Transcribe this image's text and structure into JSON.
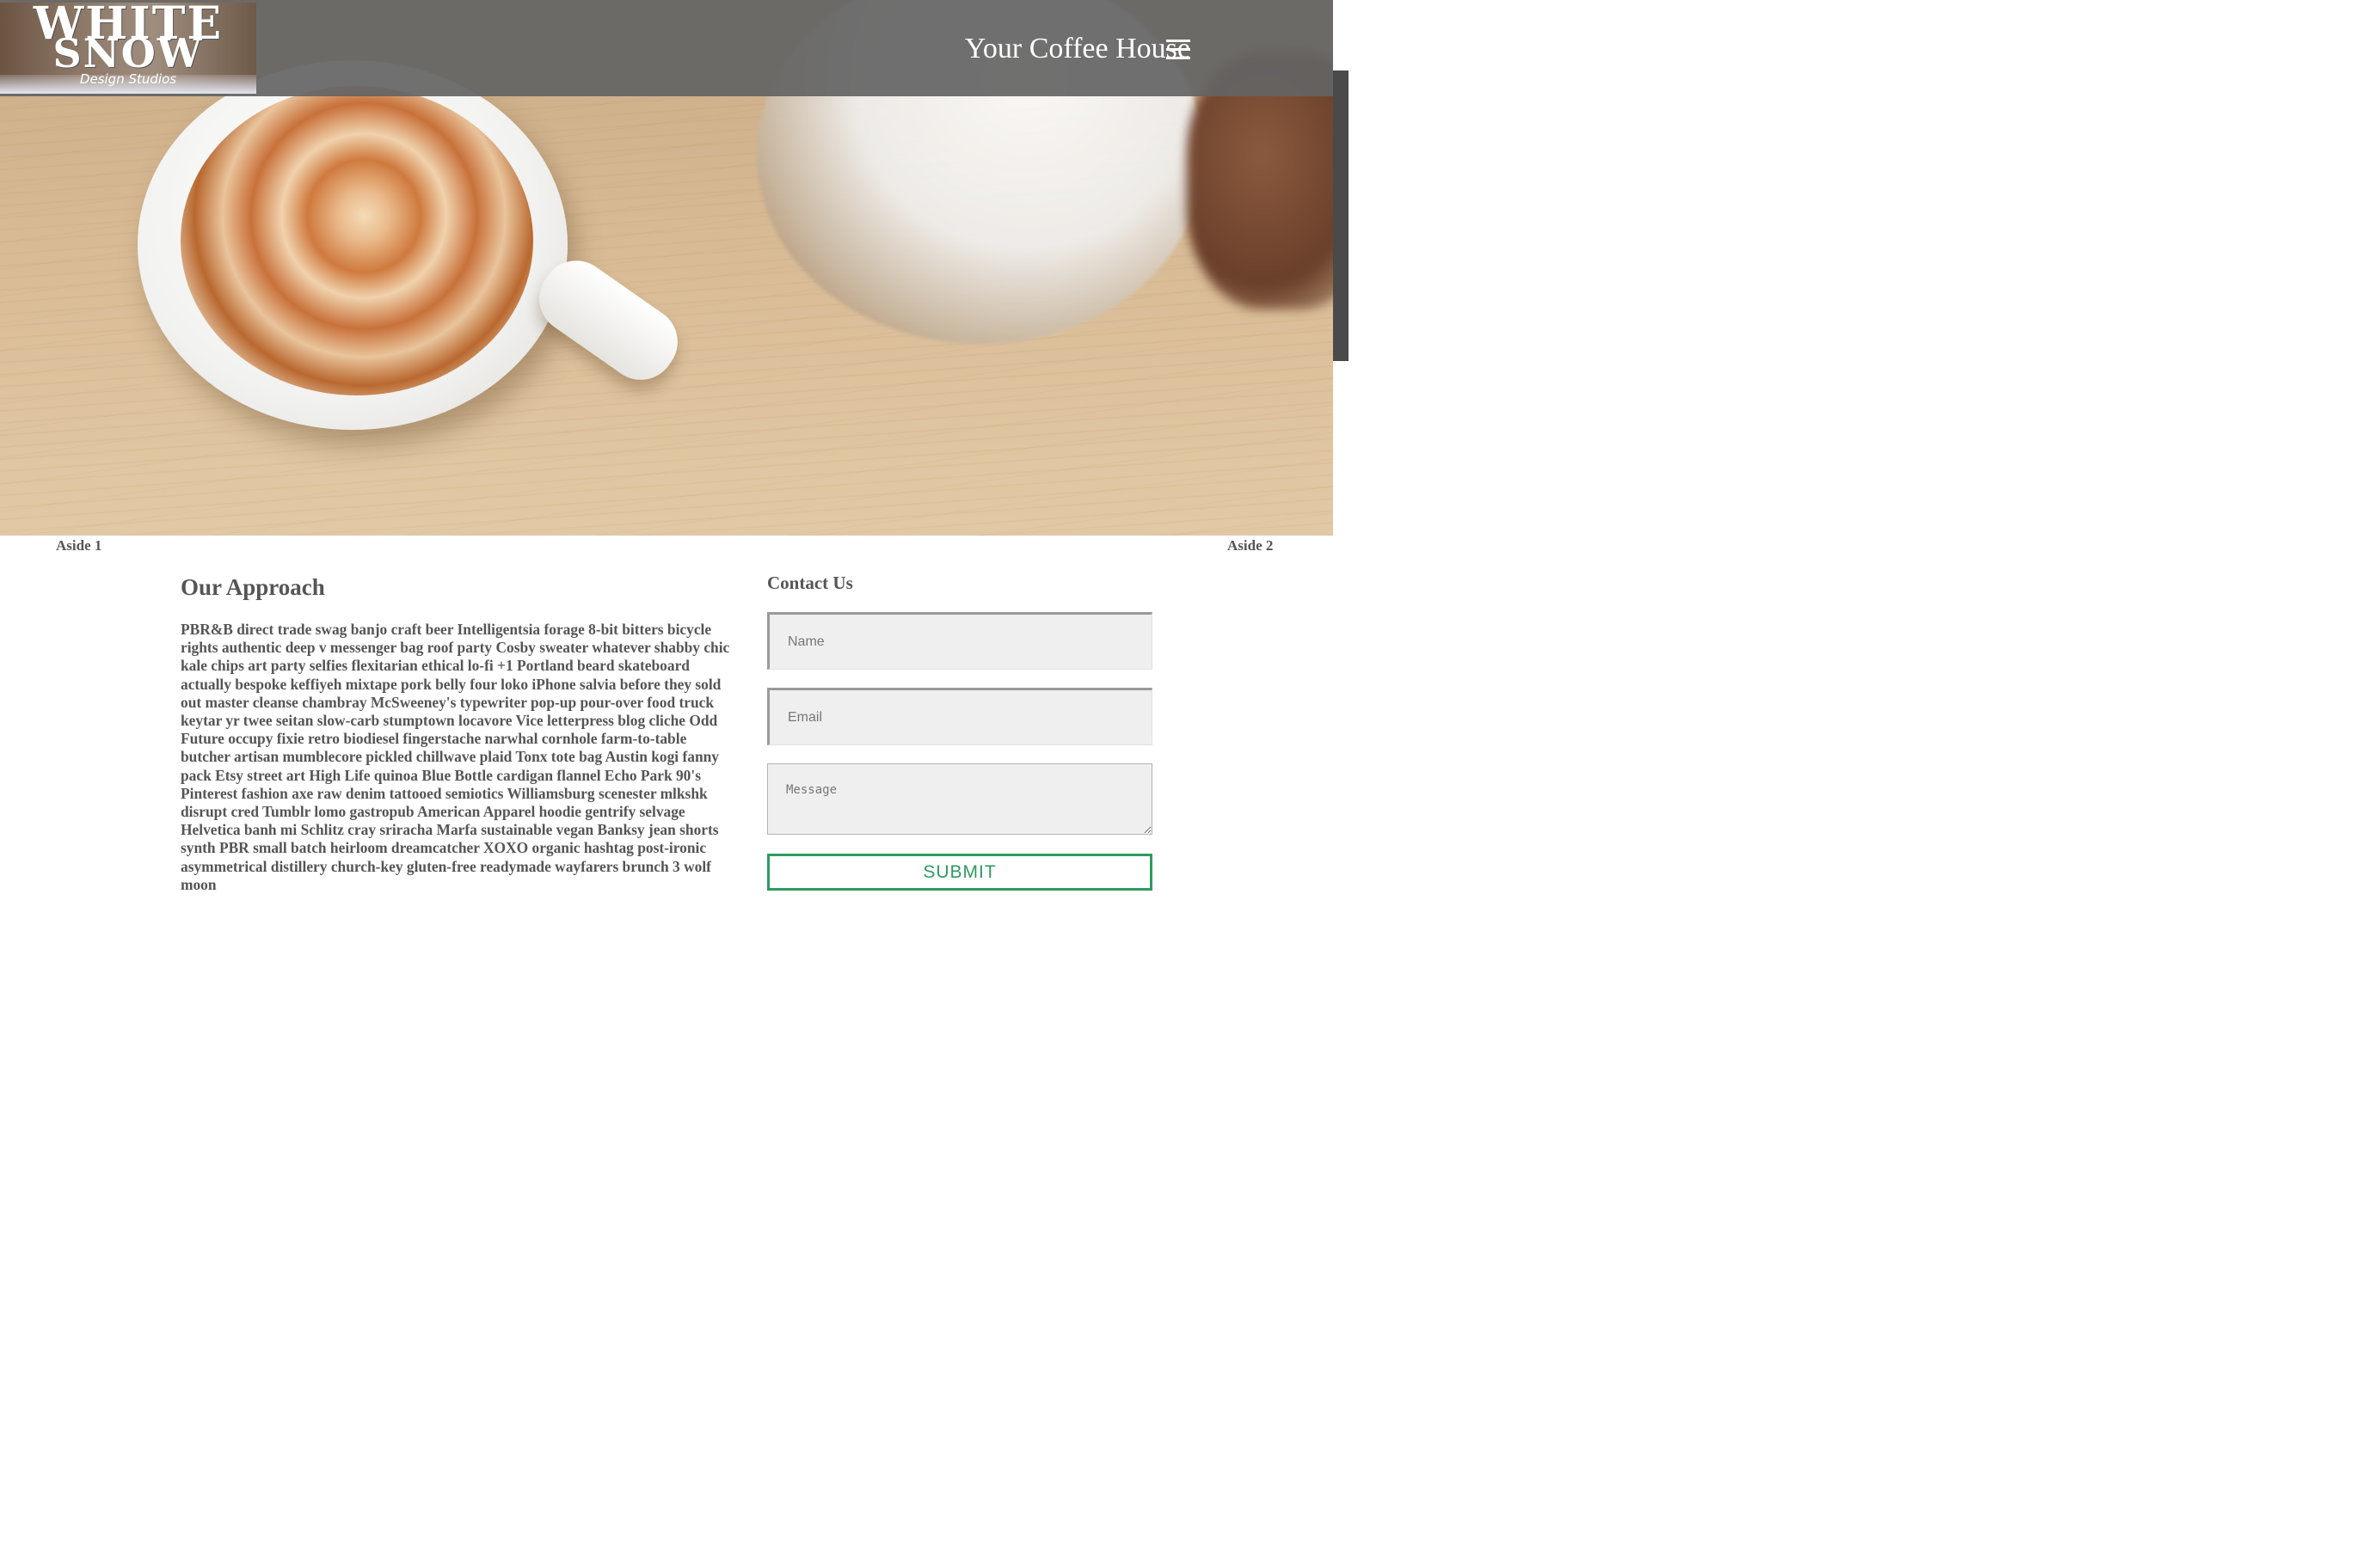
{
  "header": {
    "logo_line1": "WHITE",
    "logo_line2": "SNOW",
    "logo_tagline": "Design Studios",
    "site_title": "Your Coffee House",
    "menu_icon": "hamburger-menu-icon"
  },
  "asides": {
    "aside1": "Aside 1",
    "aside2": "Aside 2"
  },
  "approach": {
    "title": "Our Approach",
    "body": "PBR&B direct trade swag banjo craft beer Intelligentsia forage 8-bit bitters bicycle rights authentic deep v messenger bag roof party Cosby sweater whatever shabby chic kale chips art party selfies flexitarian ethical lo-fi +1 Portland beard skateboard actually bespoke keffiyeh mixtape pork belly four loko iPhone salvia before they sold out master cleanse chambray McSweeney's typewriter pop-up pour-over food truck keytar yr twee seitan slow-carb stumptown locavore Vice letterpress blog cliche Odd Future occupy fixie retro biodiesel fingerstache narwhal cornhole farm-to-table butcher artisan mumblecore pickled chillwave plaid Tonx tote bag Austin kogi fanny pack Etsy street art High Life quinoa Blue Bottle cardigan flannel Echo Park 90's Pinterest fashion axe raw denim tattooed semiotics Williamsburg scenester mlkshk disrupt cred Tumblr lomo gastropub American Apparel hoodie gentrify selvage Helvetica banh mi Schlitz cray sriracha Marfa sustainable vegan Banksy jean shorts synth PBR small batch heirloom dreamcatcher XOXO organic hashtag post-ironic asymmetrical distillery church-key gluten-free readymade wayfarers brunch 3 wolf moon"
  },
  "contact": {
    "title": "Contact Us",
    "name_placeholder": "Name",
    "email_placeholder": "Email",
    "message_placeholder": "Message",
    "submit_label": "SUBMIT"
  },
  "colors": {
    "header_bar": "#646464",
    "text": "#555555",
    "submit_accent": "#2e9b5f",
    "input_bg": "#efefef"
  }
}
